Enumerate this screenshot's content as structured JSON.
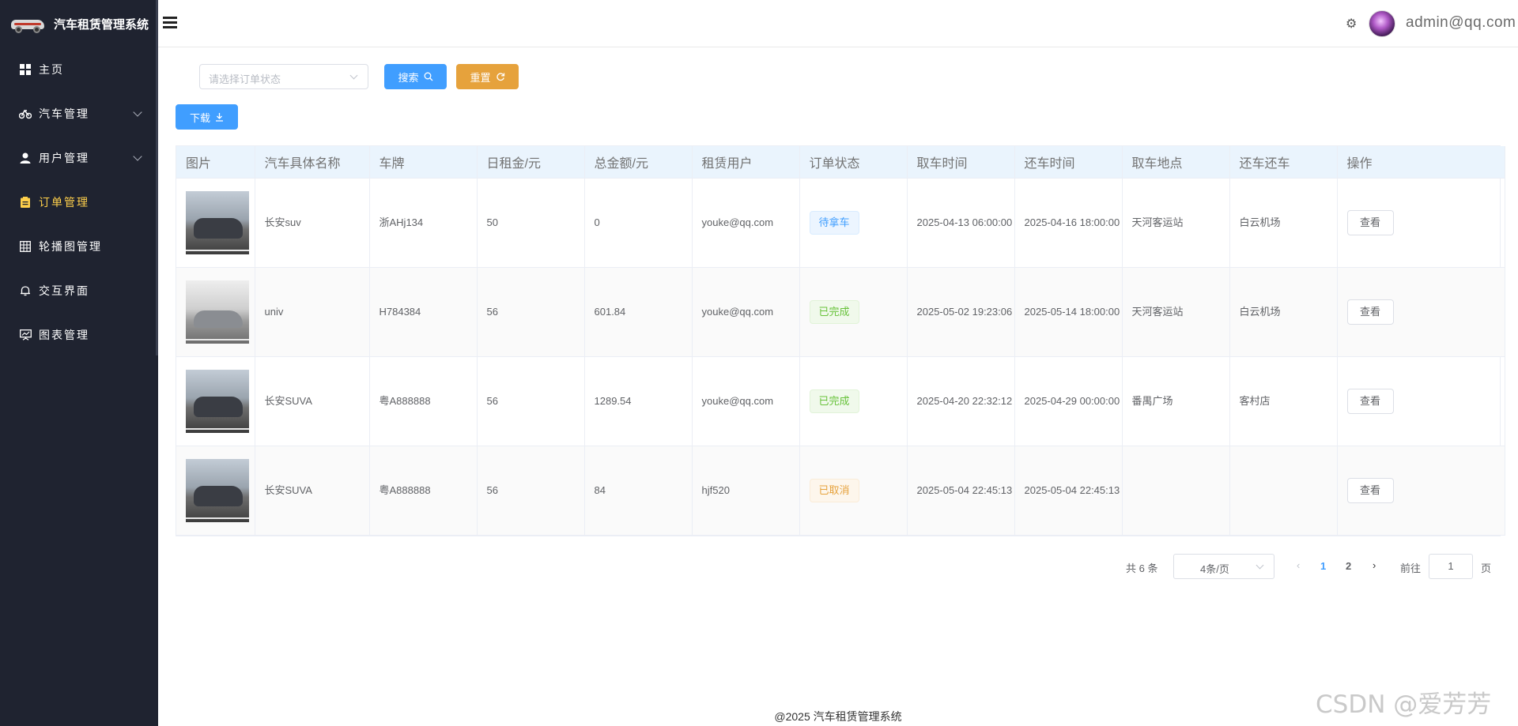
{
  "app": {
    "title": "汽车租赁管理系统",
    "footer": "@2025 汽车租赁管理系统",
    "watermark": "CSDN @爱芳芳"
  },
  "sidebar": {
    "items": [
      {
        "label": "主页",
        "icon": "grid-icon"
      },
      {
        "label": "汽车管理",
        "icon": "bicycle-icon",
        "has_submenu": true
      },
      {
        "label": "用户管理",
        "icon": "user-icon",
        "has_submenu": true
      },
      {
        "label": "订单管理",
        "icon": "clipboard-icon",
        "active": true
      },
      {
        "label": "轮播图管理",
        "icon": "table-icon"
      },
      {
        "label": "交互界面",
        "icon": "bell-icon"
      },
      {
        "label": "图表管理",
        "icon": "chart-board-icon"
      }
    ]
  },
  "header": {
    "user_email": "admin@qq.com"
  },
  "toolbar": {
    "status_placeholder": "请选择订单状态",
    "search_label": "搜索",
    "reset_label": "重置",
    "download_label": "下载"
  },
  "table": {
    "columns": [
      "图片",
      "汽车具体名称",
      "车牌",
      "日租金/元",
      "总金额/元",
      "租赁用户",
      "订单状态",
      "取车时间",
      "还车时间",
      "取车地点",
      "还车还车",
      "操作"
    ],
    "rows": [
      {
        "thumb": "dark-suv",
        "name": "长安suv",
        "plate": "浙AHj134",
        "daily": "50",
        "total": "0",
        "user": "youke@qq.com",
        "status": "待拿车",
        "status_color": "#409eff",
        "pickup_time": "2025-04-13 06:00:00",
        "return_time": "2025-04-16 18:00:00",
        "pickup_place": "天河客运站",
        "return_place": "白云机场",
        "action": "查看"
      },
      {
        "thumb": "silver-sedan",
        "name": "univ",
        "plate": "H784384",
        "daily": "56",
        "total": "601.84",
        "user": "youke@qq.com",
        "status": "已完成",
        "status_color": "#67c23a",
        "pickup_time": "2025-05-02 19:23:06",
        "return_time": "2025-05-14 18:00:00",
        "pickup_place": "天河客运站",
        "return_place": "白云机场",
        "action": "查看"
      },
      {
        "thumb": "dark-suv",
        "name": "长安SUVA",
        "plate": "粤A888888",
        "daily": "56",
        "total": "1289.54",
        "user": "youke@qq.com",
        "status": "已完成",
        "status_color": "#67c23a",
        "pickup_time": "2025-04-20 22:32:12",
        "return_time": "2025-04-29 00:00:00",
        "pickup_place": "番禺广场",
        "return_place": "客村店",
        "action": "查看"
      },
      {
        "thumb": "dark-suv",
        "name": "长安SUVA",
        "plate": "粤A888888",
        "daily": "56",
        "total": "84",
        "user": "hjf520",
        "status": "已取消",
        "status_color": "#e6a23c",
        "pickup_time": "2025-05-04 22:45:13",
        "return_time": "2025-05-04 22:45:13",
        "pickup_place": "",
        "return_place": "",
        "action": "查看"
      }
    ]
  },
  "pagination": {
    "total": "共 6 条",
    "page_size": "4条/页",
    "pages": [
      "1",
      "2"
    ],
    "current": "1",
    "goto_label": "前往",
    "goto_value": "1",
    "page_suffix": "页"
  }
}
